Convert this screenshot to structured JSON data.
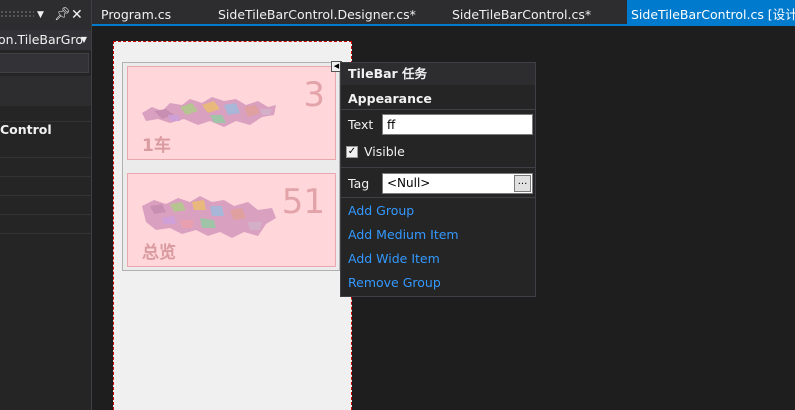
{
  "left_panel": {
    "object_selector": "on.TileBarGro",
    "category": "Control"
  },
  "tabs": [
    {
      "label": "Program.cs"
    },
    {
      "label": "SideTileBarControl.Designer.cs*"
    },
    {
      "label": "SideTileBarControl.cs*"
    },
    {
      "label": "SideTileBarControl.cs [设计]*"
    }
  ],
  "tiles": [
    {
      "count": "3",
      "label": "1车"
    },
    {
      "count": "51",
      "label": "总览"
    }
  ],
  "tasks": {
    "title": "TileBar 任务",
    "group_title": "Appearance",
    "text_label": "Text",
    "text_value": "ff",
    "visible_label": "Visible",
    "visible_checked": true,
    "tag_label": "Tag",
    "tag_value": "<Null>",
    "tag_browse": "...",
    "actions": [
      {
        "label": "Add Group"
      },
      {
        "label": "Add Medium Item"
      },
      {
        "label": "Add Wide Item"
      },
      {
        "label": "Remove Group"
      }
    ]
  },
  "colors": {
    "accent": "#007acc",
    "link": "#3399ff",
    "tile_bg": "#ffd6da"
  }
}
